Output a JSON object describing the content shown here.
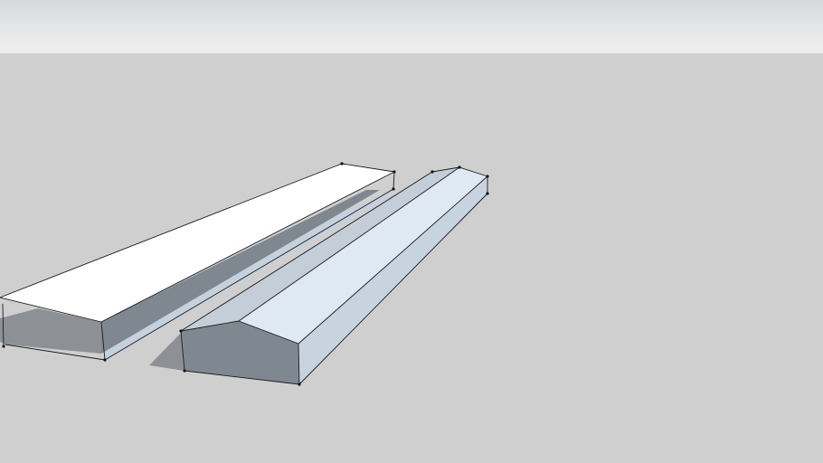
{
  "viewport": {
    "sky_color": "#e4e5e6",
    "ground_color": "#cfcfcf",
    "edge_color": "#1c1c1c"
  },
  "model": {
    "objects": [
      "flat-canopy",
      "gable-shed"
    ],
    "materials": {
      "top_face": "#ffffff",
      "roof_light": "#dfe9f4",
      "roof_shade": "#c4ced8",
      "side_wall": "#c7d3df",
      "gable_end": "#b6c3cf",
      "underside_shadow": "#7f8890",
      "ground_shadow": "#8d9196"
    }
  }
}
